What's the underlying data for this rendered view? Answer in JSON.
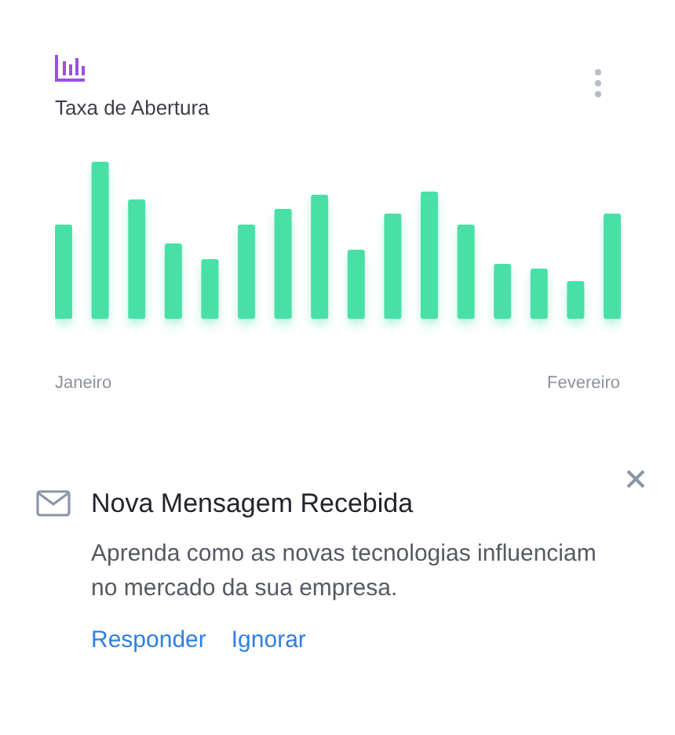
{
  "chart_card": {
    "title": "Taxa de Abertura",
    "x_labels": [
      "Janeiro",
      "Fevereiro"
    ]
  },
  "notification": {
    "title": "Nova Mensagem Recebida",
    "message": "Aprenda como as novas tecnologias influenciam no mercado da sua empresa.",
    "actions": [
      "Responder",
      "Ignorar"
    ]
  }
}
